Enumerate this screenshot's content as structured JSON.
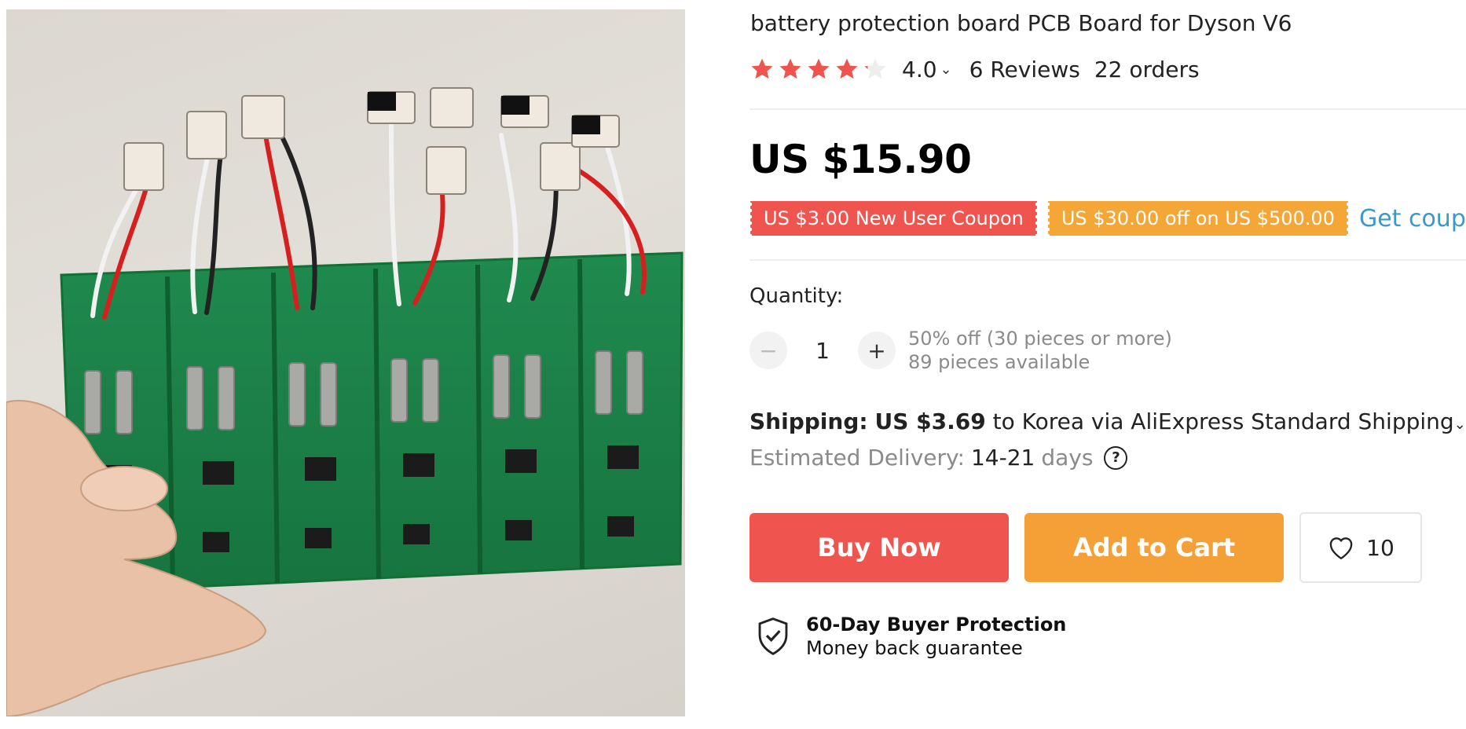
{
  "product": {
    "title": "battery protection board PCB Board for Dyson V6",
    "image_icon": "product-photo"
  },
  "rating": {
    "value": "4.0",
    "stars_filled": 4,
    "stars_total": 5,
    "reviews": "6 Reviews",
    "orders": "22 orders",
    "star_color": "#f0544f"
  },
  "price": {
    "text": "US $15.90"
  },
  "coupons": {
    "items": [
      {
        "label": "US $3.00 New User Coupon",
        "color": "#f0544f"
      },
      {
        "label": "US $30.00 off on US $500.00",
        "color": "#f4a637"
      }
    ],
    "get_label": "Get coupons"
  },
  "quantity": {
    "label": "Quantity:",
    "value": "1",
    "minus_icon": "minus-icon",
    "plus_icon": "plus-icon",
    "discount": "50% off (30 pieces or more)",
    "available": "89 pieces available"
  },
  "shipping": {
    "label": "Shipping:",
    "price": "US $3.69",
    "detail": "to Korea via AliExpress Standard Shipping",
    "delivery_label": "Estimated Delivery:",
    "delivery_days": "14-21",
    "days_word": "days",
    "help_symbol": "?"
  },
  "actions": {
    "buy_now": "Buy Now",
    "add_to_cart": "Add to Cart",
    "wishlist_count": "10",
    "buy_color": "#f0544f",
    "cart_color": "#f4a037"
  },
  "protection": {
    "title": "60-Day Buyer Protection",
    "subtitle": "Money back guarantee",
    "icon": "shield-check-icon"
  }
}
